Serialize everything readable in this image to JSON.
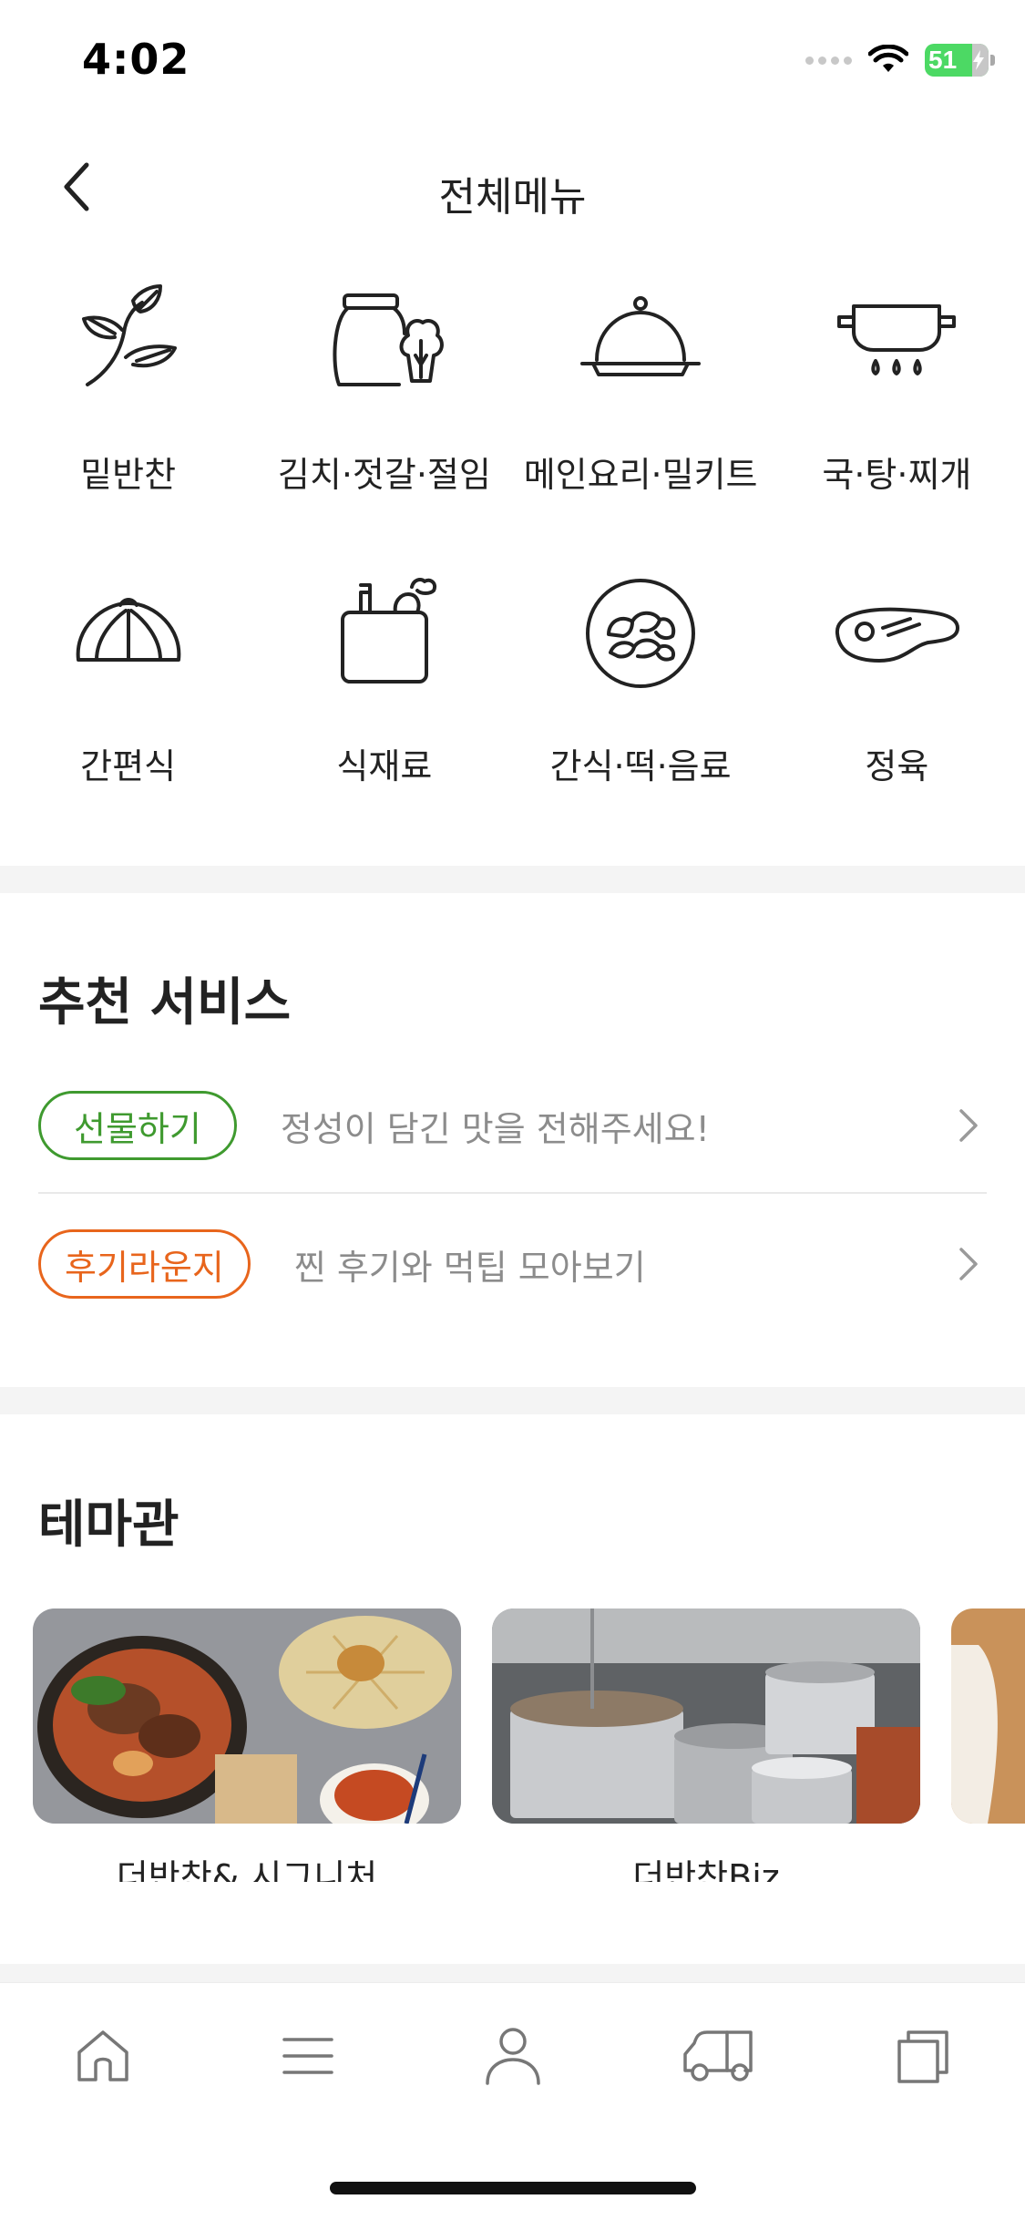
{
  "status": {
    "time": "4:02",
    "battery": "51"
  },
  "header": {
    "title": "전체메뉴"
  },
  "categories": [
    {
      "label": "밑반찬",
      "icon": "leaf-sprout-icon"
    },
    {
      "label": "김치·젓갈·절임",
      "icon": "jar-cabbage-icon"
    },
    {
      "label": "메인요리·밀키트",
      "icon": "cloche-icon"
    },
    {
      "label": "국·탕·찌개",
      "icon": "pot-icon"
    },
    {
      "label": "간편식",
      "icon": "dumpling-icon"
    },
    {
      "label": "식재료",
      "icon": "grocery-bag-icon"
    },
    {
      "label": "간식·떡·음료",
      "icon": "rice-cake-plate-icon"
    },
    {
      "label": "정육",
      "icon": "steak-icon"
    }
  ],
  "recommend": {
    "title": "추천 서비스",
    "items": [
      {
        "pill": "선물하기",
        "desc": "정성이 담긴 맛을 전해주세요!",
        "color": "#3f9a2f"
      },
      {
        "pill": "후기라운지",
        "desc": "찐 후기와 먹팁 모아보기",
        "color": "#e8651c"
      }
    ]
  },
  "theme": {
    "title": "테마관",
    "cards": [
      {
        "label": "더반찬& 시그니처"
      },
      {
        "label": "더반찬Biz"
      }
    ]
  },
  "bottom_nav": [
    "home-icon",
    "menu-icon",
    "user-icon",
    "delivery-truck-icon",
    "recent-view-icon"
  ]
}
